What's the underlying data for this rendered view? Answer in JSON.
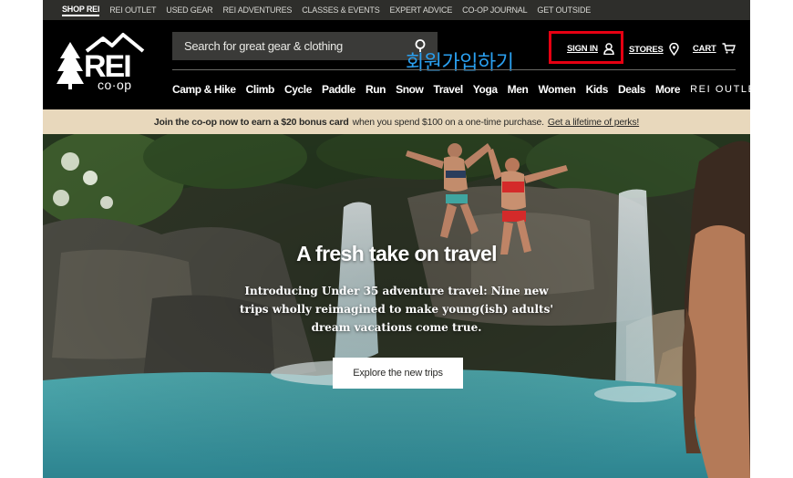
{
  "utility_nav": [
    "SHOP REI",
    "REI OUTLET",
    "USED GEAR",
    "REI ADVENTURES",
    "CLASSES & EVENTS",
    "EXPERT ADVICE",
    "CO-OP JOURNAL",
    "GET OUTSIDE"
  ],
  "logo": {
    "text": "REI",
    "subtext": "co·op"
  },
  "search": {
    "placeholder": "Search for great gear & clothing",
    "icon": "search-icon"
  },
  "header_links": {
    "sign_in": "SIGN IN",
    "stores": "STORES",
    "cart": "CART"
  },
  "annotation": {
    "text": "회원가입하기",
    "color": "#2aa0f0",
    "box_color": "#e60012"
  },
  "main_nav": [
    "Camp & Hike",
    "Climb",
    "Cycle",
    "Paddle",
    "Run",
    "Snow",
    "Travel",
    "Yoga",
    "Men",
    "Women",
    "Kids",
    "Deals",
    "More"
  ],
  "outlet_link": "REI OUTLET",
  "promo": {
    "bold": "Join the co-op now to earn a $20 bonus card",
    "rest": "when you spend $100 on a one-time purchase.",
    "link": "Get a lifetime of perks!"
  },
  "hero": {
    "title": "A fresh take on travel",
    "body": "Introducing Under 35 adventure travel: Nine new trips wholly reimagined to make young(ish) adults' dream vacations come true.",
    "cta": "Explore the new trips"
  },
  "colors": {
    "promo_bg": "#e8d8bc",
    "utility_bg": "#2e2e2b",
    "search_bg": "#3a3a38",
    "water": "#3d9aa4"
  }
}
